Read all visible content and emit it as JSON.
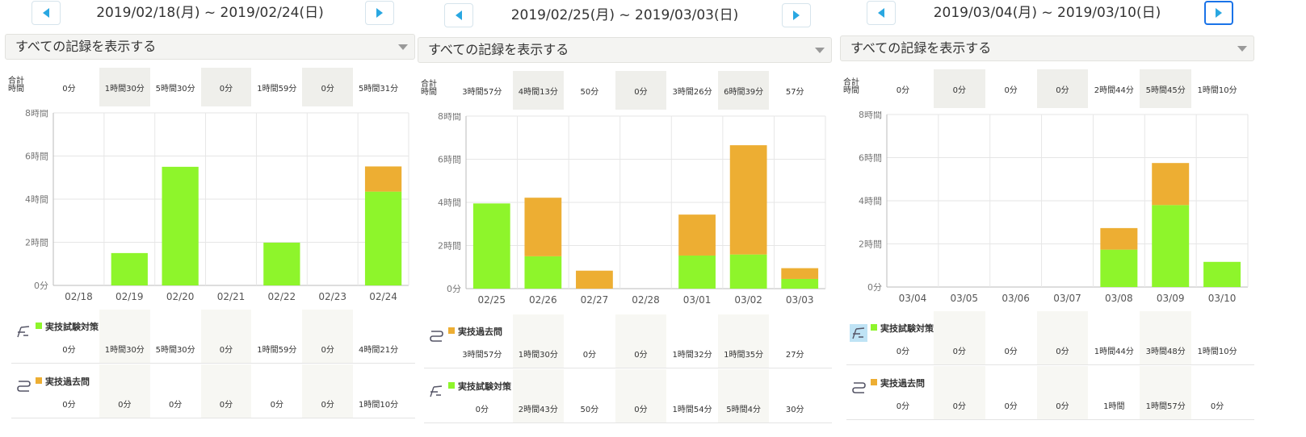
{
  "colors": {
    "practical": "#8ef52b",
    "past": "#edae33",
    "accent": "#29a7e1"
  },
  "filter_label": "すべての記録を表示する",
  "totals_label_line1": "合計",
  "totals_label_line2": "時間",
  "y_ticks": [
    "8時間",
    "6時間",
    "4時間",
    "2時間",
    "0分"
  ],
  "legend": {
    "practical": "実技試験対策",
    "past": "実技過去問"
  },
  "weeks": [
    {
      "range": "2019/02/18(月) ~ 2019/02/24(日)",
      "prev_active": false,
      "next_active": false,
      "totals": [
        "0分",
        "1時間30分",
        "5時間30分",
        "0分",
        "1時間59分",
        "0分",
        "5時間31分"
      ],
      "shade_cols": [
        1,
        3,
        5
      ],
      "chart_data": {
        "type": "bar",
        "categories": [
          "02/18",
          "02/19",
          "02/20",
          "02/21",
          "02/22",
          "02/23",
          "02/24"
        ],
        "ylim": [
          0,
          480
        ],
        "series": [
          {
            "name": "実技試験対策",
            "values": [
              0,
              90,
              330,
              0,
              119,
              0,
              261
            ]
          },
          {
            "name": "実技過去問",
            "values": [
              0,
              0,
              0,
              0,
              0,
              0,
              70
            ]
          }
        ]
      },
      "legend_order": [
        "practical",
        "past"
      ],
      "rows": [
        [
          "0分",
          "1時間30分",
          "5時間30分",
          "0分",
          "1時間59分",
          "0分",
          "4時間21分"
        ],
        [
          "0分",
          "0分",
          "0分",
          "0分",
          "0分",
          "0分",
          "1時間10分"
        ]
      ]
    },
    {
      "range": "2019/02/25(月) ~ 2019/03/03(日)",
      "prev_active": false,
      "next_active": false,
      "totals": [
        "3時間57分",
        "4時間13分",
        "50分",
        "0分",
        "3時間26分",
        "6時間39分",
        "57分"
      ],
      "shade_cols": [
        1,
        3,
        5
      ],
      "chart_data": {
        "type": "bar",
        "categories": [
          "02/25",
          "02/26",
          "02/27",
          "02/28",
          "03/01",
          "03/02",
          "03/03"
        ],
        "ylim": [
          0,
          480
        ],
        "series": [
          {
            "name": "実技試験対策",
            "values": [
              237,
              90,
              0,
              0,
              92,
              95,
              27
            ]
          },
          {
            "name": "実技過去問",
            "values": [
              0,
              163,
              50,
              0,
              114,
              304,
              30
            ]
          }
        ]
      },
      "legend_order": [
        "past",
        "practical"
      ],
      "rows": [
        [
          "3時間57分",
          "1時間30分",
          "0分",
          "0分",
          "1時間32分",
          "1時間35分",
          "27分"
        ],
        [
          "0分",
          "2時間43分",
          "50分",
          "0分",
          "1時間54分",
          "5時間4分",
          "30分"
        ]
      ]
    },
    {
      "range": "2019/03/04(月) ~ 2019/03/10(日)",
      "prev_active": false,
      "next_active": true,
      "totals": [
        "0分",
        "0分",
        "0分",
        "0分",
        "2時間44分",
        "5時間45分",
        "1時間10分"
      ],
      "shade_cols": [
        1,
        3,
        5
      ],
      "chart_data": {
        "type": "bar",
        "categories": [
          "03/04",
          "03/05",
          "03/06",
          "03/07",
          "03/08",
          "03/09",
          "03/10"
        ],
        "ylim": [
          0,
          480
        ],
        "series": [
          {
            "name": "実技試験対策",
            "values": [
              0,
              0,
              0,
              0,
              104,
              228,
              70
            ]
          },
          {
            "name": "実技過去問",
            "values": [
              0,
              0,
              0,
              0,
              60,
              117,
              0
            ]
          }
        ]
      },
      "legend_order": [
        "practical",
        "past"
      ],
      "highlight_first_icon": true,
      "rows": [
        [
          "0分",
          "0分",
          "0分",
          "0分",
          "1時間44分",
          "3時間48分",
          "1時間10分"
        ],
        [
          "0分",
          "0分",
          "0分",
          "0分",
          "1時間",
          "1時間57分",
          "0分"
        ]
      ]
    }
  ]
}
